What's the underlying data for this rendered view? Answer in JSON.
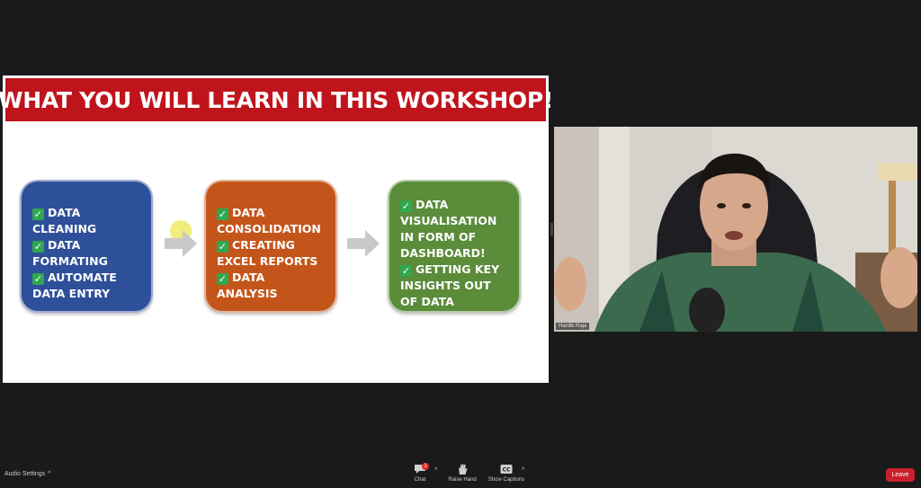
{
  "slide": {
    "title": "WHAT YOU WILL LEARN IN THIS WORKSHOP!",
    "boxes": [
      {
        "color": "#2e4f9a",
        "items": [
          "DATA CLEANING",
          "DATA FORMATING",
          "AUTOMATE DATA ENTRY"
        ]
      },
      {
        "color": "#c4551a",
        "items": [
          "DATA CONSOLIDATION",
          "CREATING EXCEL REPORTS",
          "DATA ANALYSIS"
        ]
      },
      {
        "color": "#5a8c3a",
        "items": [
          "DATA VISUALISATION IN FORM OF DASHBOARD!",
          "GETTING KEY INSIGHTS OUT OF DATA"
        ]
      }
    ],
    "check_icon": "check-mark-icon",
    "arrow_icon": "arrow-right-icon",
    "banner_color": "#c0141c"
  },
  "participant": {
    "name": "Hardik Raja"
  },
  "toolbar": {
    "audio_settings_label": "Audio Settings",
    "chat_label": "Chat",
    "chat_badge": "1",
    "raise_hand_label": "Raise Hand",
    "captions_label": "Show Captions",
    "captions_icon_text": "CC",
    "caret": "^",
    "leave_label": "Leave",
    "leave_color": "#c8202c"
  }
}
